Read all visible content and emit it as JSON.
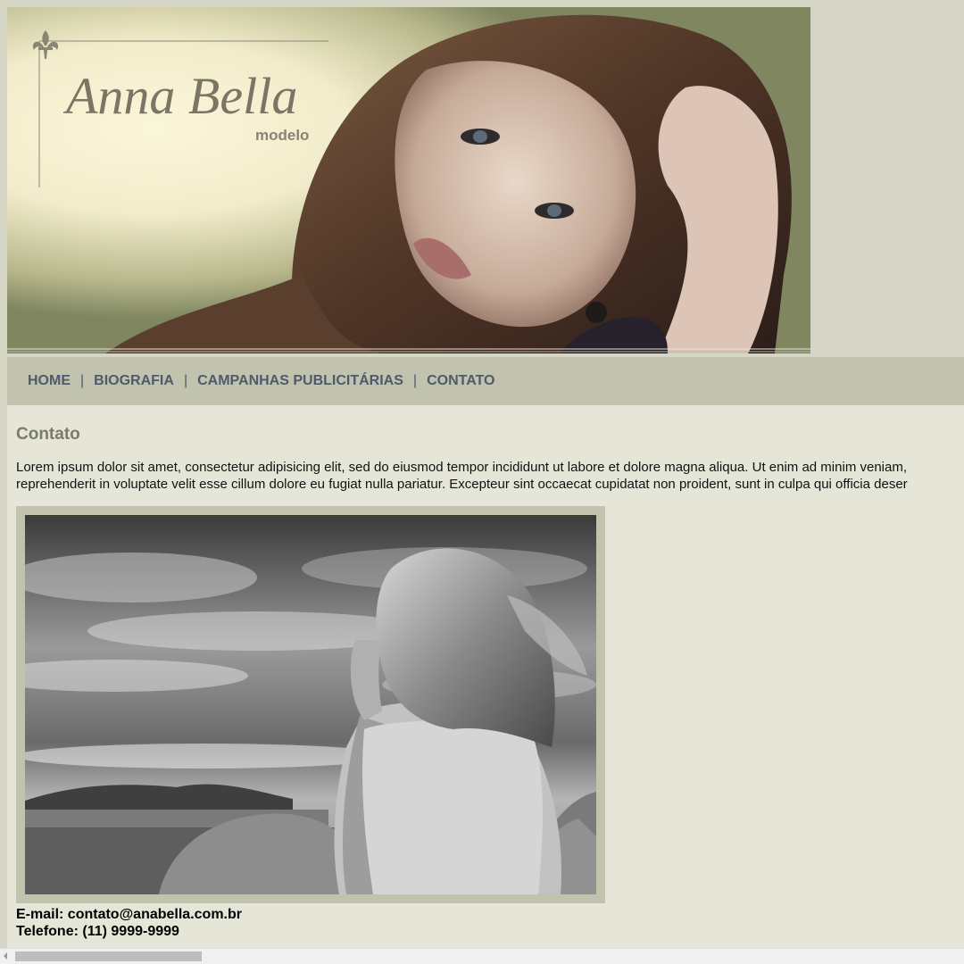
{
  "banner": {
    "title": "Anna Bella",
    "subtitle": "modelo"
  },
  "nav": {
    "items": [
      {
        "label": "HOME"
      },
      {
        "label": "BIOGRAFIA"
      },
      {
        "label": "CAMPANHAS PUBLICITÁRIAS"
      },
      {
        "label": "CONTATO"
      }
    ],
    "separator": "|"
  },
  "content": {
    "title": "Contato",
    "paragraph_line1": "Lorem ipsum dolor sit amet, consectetur adipisicing elit, sed do eiusmod tempor incididunt ut labore et dolore magna aliqua. Ut enim ad minim veniam,",
    "paragraph_line2": "reprehenderit in voluptate velit esse cillum dolore eu fugiat nulla pariatur. Excepteur sint occaecat cupidatat non proident, sunt in culpa qui officia deser",
    "email": "E-mail: contato@anabella.com.br",
    "phone": "Telefone: (11) 9999-9999"
  },
  "colors": {
    "page_bg": "#d5d6c5",
    "nav_bg": "#c2c3ae",
    "content_bg": "#e6e6d8",
    "nav_text": "#4f5a6a",
    "title_text": "#7a7b6c"
  },
  "icons": {
    "logo": "fleur-de-lis-icon",
    "scroll_left": "chevron-left-icon"
  }
}
